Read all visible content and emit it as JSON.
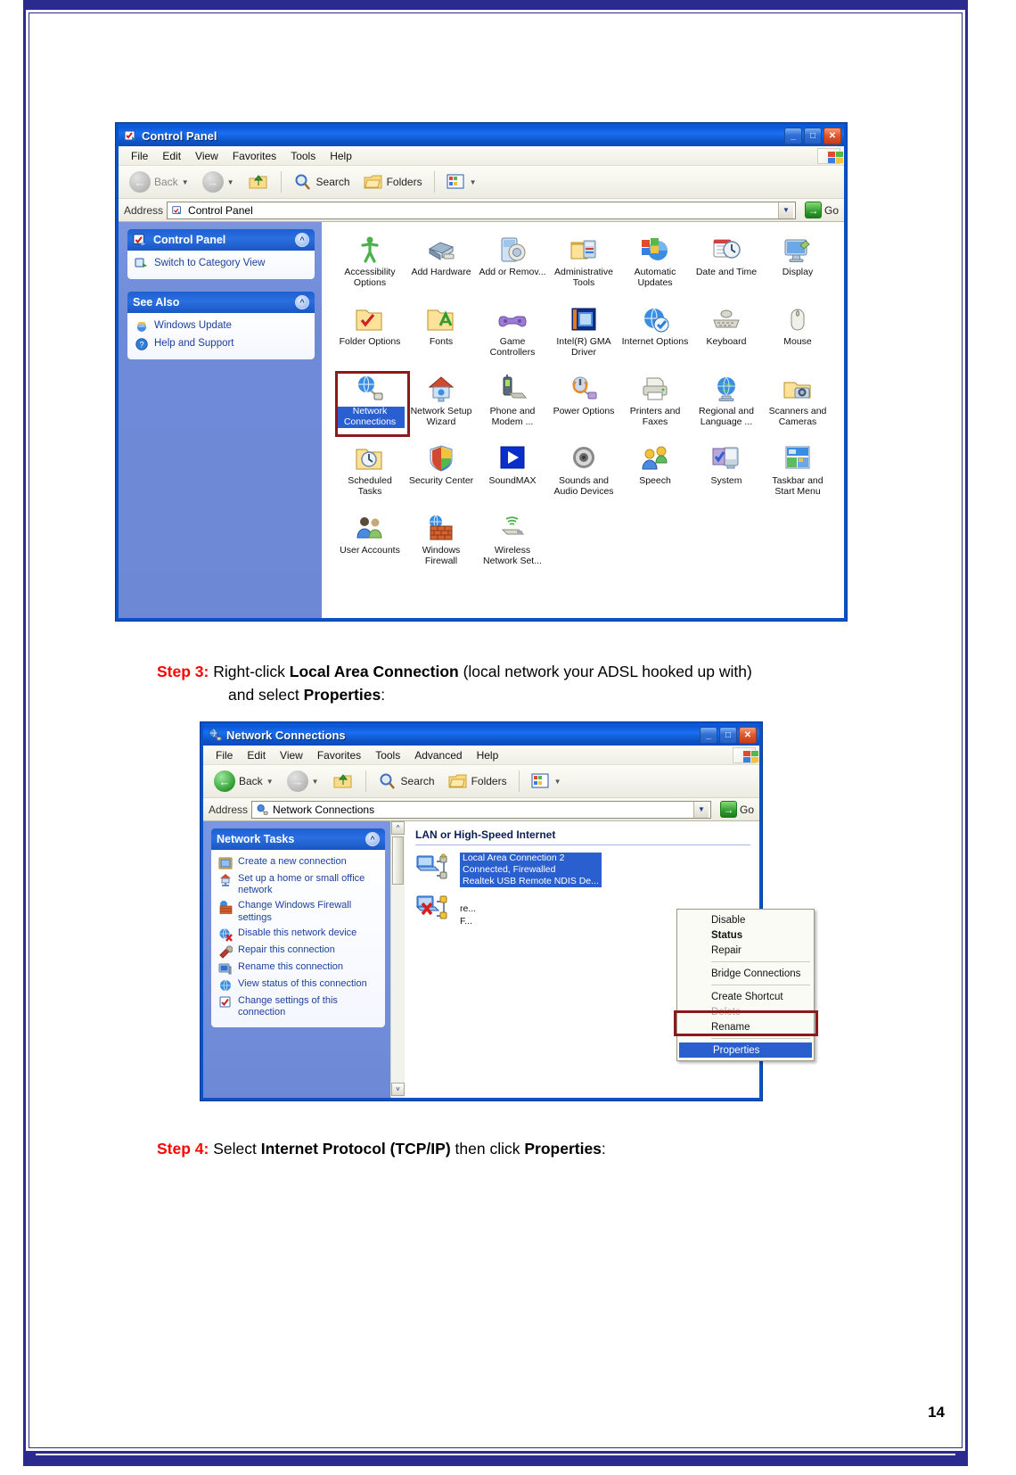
{
  "document": {
    "page_number": "14",
    "step3": {
      "number": "Step 3:",
      "line1_pre": " Right-click ",
      "line1_bold": "Local Area Connection",
      "line1_post": " (local network your ADSL hooked up with)",
      "line2_pre": "and select ",
      "line2_bold": "Properties",
      "line2_post": ":"
    },
    "step4": {
      "number": "Step 4:",
      "pre": " Select ",
      "bold1": "Internet Protocol (TCP/IP)",
      "mid": " then click ",
      "bold2": "Properties",
      "post": ":"
    }
  },
  "control_panel_window": {
    "title": "Control Panel",
    "title_icon": "control-panel-icon",
    "window_buttons": {
      "minimize": "_",
      "maximize": "□",
      "close": "✕"
    },
    "menu": [
      "File",
      "Edit",
      "View",
      "Favorites",
      "Tools",
      "Help"
    ],
    "toolbar": {
      "back": "Back",
      "forward": "",
      "up": "",
      "search": "Search",
      "folders": "Folders",
      "views": ""
    },
    "address": {
      "label": "Address",
      "value": "Control Panel",
      "go": "Go"
    },
    "sidebar": {
      "panel1": {
        "title": "Control Panel",
        "items": [
          {
            "label": "Switch to Category View",
            "icon": "category-view-icon"
          }
        ]
      },
      "panel2": {
        "title": "See Also",
        "items": [
          {
            "label": "Windows Update",
            "icon": "windows-update-icon"
          },
          {
            "label": "Help and Support",
            "icon": "help-support-icon"
          }
        ]
      }
    },
    "icons": [
      {
        "label": "Accessibility Options",
        "icon": "accessibility-icon",
        "selected": false
      },
      {
        "label": "Add Hardware",
        "icon": "add-hardware-icon",
        "selected": false
      },
      {
        "label": "Add or Remov...",
        "icon": "add-remove-programs-icon",
        "selected": false
      },
      {
        "label": "Administrative Tools",
        "icon": "administrative-tools-icon",
        "selected": false
      },
      {
        "label": "Automatic Updates",
        "icon": "automatic-updates-icon",
        "selected": false
      },
      {
        "label": "Date and Time",
        "icon": "date-time-icon",
        "selected": false
      },
      {
        "label": "Display",
        "icon": "display-icon",
        "selected": false
      },
      {
        "label": "Folder Options",
        "icon": "folder-options-icon",
        "selected": false
      },
      {
        "label": "Fonts",
        "icon": "fonts-icon",
        "selected": false
      },
      {
        "label": "Game Controllers",
        "icon": "game-controllers-icon",
        "selected": false
      },
      {
        "label": "Intel(R) GMA Driver",
        "icon": "intel-gma-driver-icon",
        "selected": false
      },
      {
        "label": "Internet Options",
        "icon": "internet-options-icon",
        "selected": false
      },
      {
        "label": "Keyboard",
        "icon": "keyboard-icon",
        "selected": false
      },
      {
        "label": "Mouse",
        "icon": "mouse-icon",
        "selected": false
      },
      {
        "label": "Network Connections",
        "icon": "network-connections-icon",
        "selected": true
      },
      {
        "label": "Network Setup Wizard",
        "icon": "network-setup-wizard-icon",
        "selected": false
      },
      {
        "label": "Phone and Modem ...",
        "icon": "phone-modem-icon",
        "selected": false
      },
      {
        "label": "Power Options",
        "icon": "power-options-icon",
        "selected": false
      },
      {
        "label": "Printers and Faxes",
        "icon": "printers-faxes-icon",
        "selected": false
      },
      {
        "label": "Regional and Language ...",
        "icon": "regional-language-icon",
        "selected": false
      },
      {
        "label": "Scanners and Cameras",
        "icon": "scanners-cameras-icon",
        "selected": false
      },
      {
        "label": "Scheduled Tasks",
        "icon": "scheduled-tasks-icon",
        "selected": false
      },
      {
        "label": "Security Center",
        "icon": "security-center-icon",
        "selected": false
      },
      {
        "label": "SoundMAX",
        "icon": "soundmax-icon",
        "selected": false
      },
      {
        "label": "Sounds and Audio Devices",
        "icon": "sounds-audio-icon",
        "selected": false
      },
      {
        "label": "Speech",
        "icon": "speech-icon",
        "selected": false
      },
      {
        "label": "System",
        "icon": "system-icon",
        "selected": false
      },
      {
        "label": "Taskbar and Start Menu",
        "icon": "taskbar-start-menu-icon",
        "selected": false
      },
      {
        "label": "User Accounts",
        "icon": "user-accounts-icon",
        "selected": false
      },
      {
        "label": "Windows Firewall",
        "icon": "windows-firewall-icon",
        "selected": false
      },
      {
        "label": "Wireless Network Set...",
        "icon": "wireless-network-setup-icon",
        "selected": false
      }
    ]
  },
  "network_connections_window": {
    "title": "Network Connections",
    "title_icon": "network-connections-icon",
    "window_buttons": {
      "minimize": "_",
      "maximize": "□",
      "close": "✕"
    },
    "menu": [
      "File",
      "Edit",
      "View",
      "Favorites",
      "Tools",
      "Advanced",
      "Help"
    ],
    "toolbar": {
      "back": "Back",
      "search": "Search",
      "folders": "Folders"
    },
    "address": {
      "label": "Address",
      "value": "Network Connections",
      "go": "Go"
    },
    "sidebar": {
      "panel_title": "Network Tasks",
      "items": [
        {
          "label": "Create a new connection",
          "icon": "new-connection-icon"
        },
        {
          "label": "Set up a home or small office network",
          "icon": "home-network-icon"
        },
        {
          "label": "Change Windows Firewall settings",
          "icon": "firewall-icon"
        },
        {
          "label": "Disable this network device",
          "icon": "disable-device-icon"
        },
        {
          "label": "Repair this connection",
          "icon": "repair-icon"
        },
        {
          "label": "Rename this connection",
          "icon": "rename-icon"
        },
        {
          "label": "View status of this connection",
          "icon": "status-icon"
        },
        {
          "label": "Change settings of this connection",
          "icon": "settings-icon"
        }
      ]
    },
    "main": {
      "group_title": "LAN or High-Speed Internet",
      "connections": [
        {
          "name": "Local Area Connection 2",
          "status": "Connected, Firewalled",
          "device": "Realtek USB Remote NDIS De...",
          "icon": "lan-connection-icon",
          "selected": true
        },
        {
          "name": "",
          "status": "re...",
          "device": "F...",
          "icon": "lan-connection-disabled-icon",
          "selected": false
        }
      ]
    },
    "context_menu": {
      "items": [
        {
          "label": "Disable",
          "bold": false,
          "disabled": false,
          "highlighted": false
        },
        {
          "label": "Status",
          "bold": true,
          "disabled": false,
          "highlighted": false
        },
        {
          "label": "Repair",
          "bold": false,
          "disabled": false,
          "highlighted": false
        },
        {
          "separator": true
        },
        {
          "label": "Bridge Connections",
          "bold": false,
          "disabled": false,
          "highlighted": false
        },
        {
          "separator": true
        },
        {
          "label": "Create Shortcut",
          "bold": false,
          "disabled": false,
          "highlighted": false
        },
        {
          "label": "Delete",
          "bold": false,
          "disabled": true,
          "highlighted": false
        },
        {
          "label": "Rename",
          "bold": false,
          "disabled": false,
          "highlighted": false
        },
        {
          "separator": true
        },
        {
          "label": "Properties",
          "bold": false,
          "disabled": false,
          "highlighted": true
        }
      ]
    }
  },
  "colors": {
    "accent_red": "#ff0000",
    "highlight_box": "#8b1a1a",
    "selection_blue": "#2a5fd0",
    "title_blue": "#0a55d6",
    "border_navy": "#2b2b8f"
  }
}
